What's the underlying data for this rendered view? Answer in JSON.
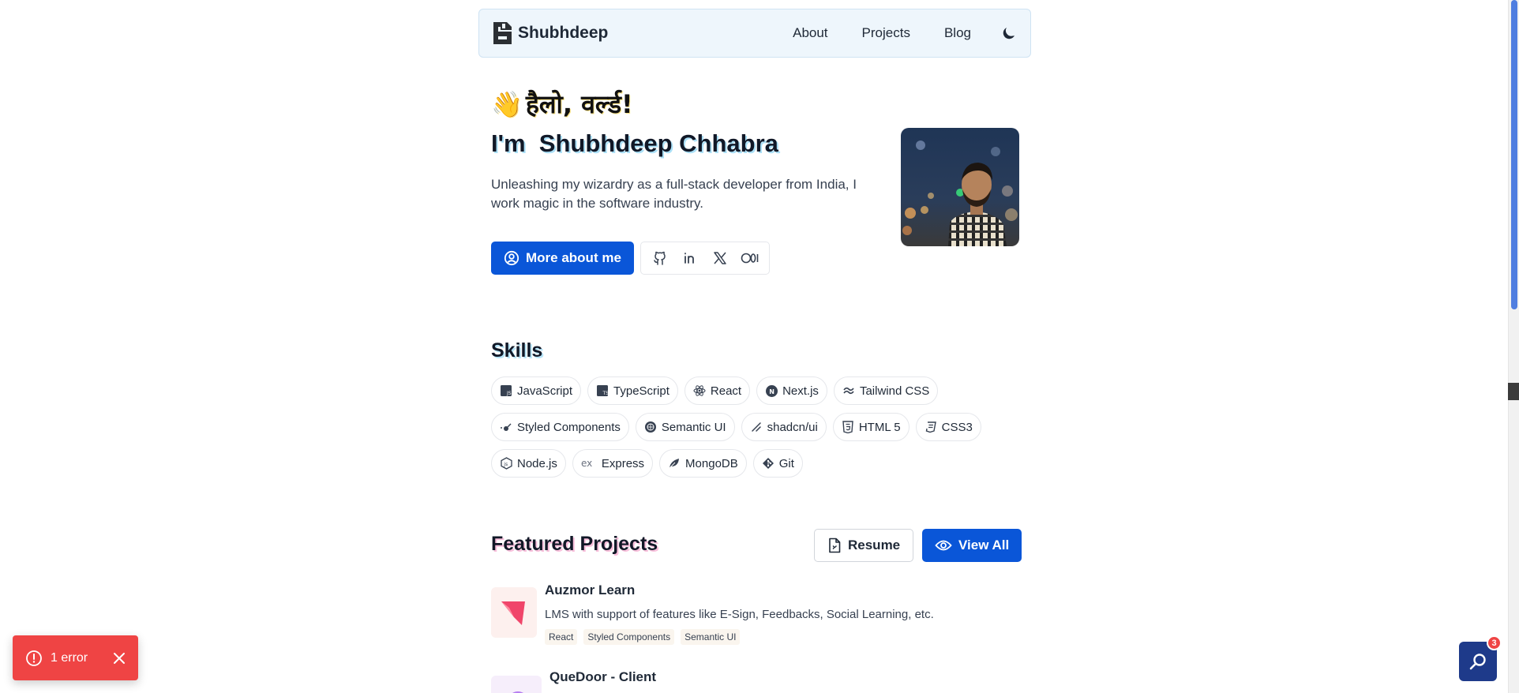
{
  "header": {
    "brand_name": "Shubhdeep",
    "nav": [
      "About",
      "Projects",
      "Blog"
    ],
    "theme_icon": "moon-icon"
  },
  "hero": {
    "greeting_emoji": "👋",
    "greeting": "हैलो, वर्ल्ड!",
    "title": "I'm  Shubhdeep Chhabra",
    "description": "Unleashing my wizardry as a full-stack developer from India, I work magic in the software industry.",
    "cta_label": "More about me",
    "socials": [
      "github-icon",
      "linkedin-icon",
      "x-icon",
      "medium-icon"
    ]
  },
  "skills": {
    "title": "Skills",
    "items": [
      "JavaScript",
      "TypeScript",
      "React",
      "Next.js",
      "Tailwind CSS",
      "Styled Components",
      "Semantic UI",
      "shadcn/ui",
      "HTML 5",
      "CSS3",
      "Node.js",
      "Express",
      "MongoDB",
      "Git"
    ]
  },
  "projects": {
    "title": "Featured Projects",
    "resume_label": "Resume",
    "view_all_label": "View All",
    "items": [
      {
        "name": "Auzmor Learn",
        "description": "LMS with support of features like E-Sign, Feedbacks, Social Learning, etc.",
        "tags": [
          "React",
          "Styled Components",
          "Semantic UI"
        ]
      },
      {
        "name": "QueDoor - Client"
      }
    ]
  },
  "toast": {
    "message": "1 error"
  },
  "widget": {
    "badge": "3"
  }
}
